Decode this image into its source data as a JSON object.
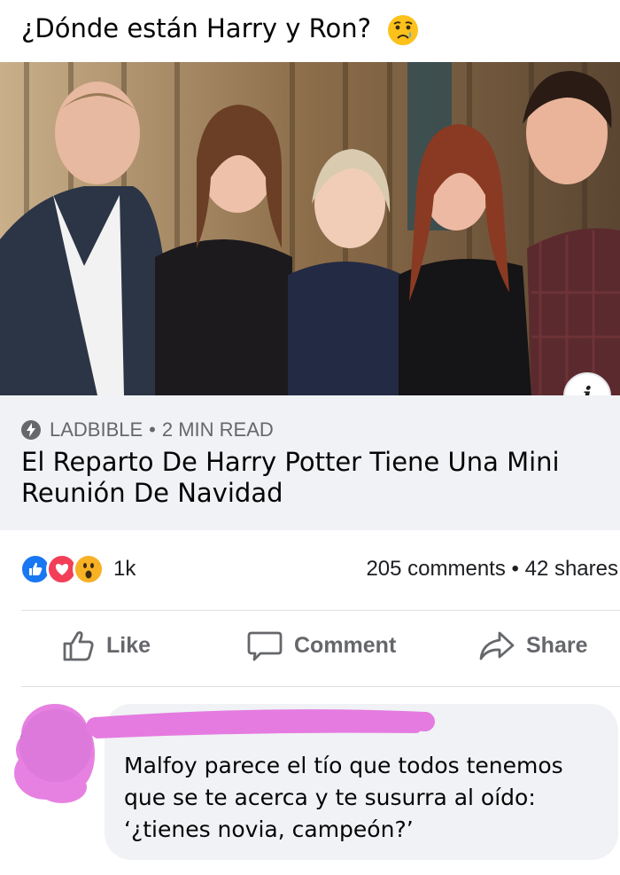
{
  "post": {
    "text": "¿Dónde están Harry y Ron?",
    "emoji_icon": "crying-face-emoji"
  },
  "link_card": {
    "source": "LADBIBLE",
    "separator": "•",
    "read_time": "2 MIN READ",
    "headline": "El Reparto De Harry Potter Tiene Una Mini Reunión De Navidad",
    "info_label": "i"
  },
  "reactions": {
    "icons": [
      "like-reaction-icon",
      "love-reaction-icon",
      "wow-reaction-icon"
    ],
    "count": "1k",
    "comments": "205 comments",
    "separator": "•",
    "shares": "42 shares"
  },
  "actions": {
    "like": "Like",
    "comment": "Comment",
    "share": "Share"
  },
  "comment": {
    "author": "",
    "text": "Malfoy parece el tío que todos tenemos que se te acerca y te susurra al oído: ‘¿tienes novia, campeón?’"
  },
  "colors": {
    "facebook_blue": "#1877f2",
    "love_red": "#f33e58",
    "wow_yellow": "#f7b125",
    "card_gray": "#f0f2f5",
    "muted_text": "#65676b",
    "scribble_pink": "#e57be0"
  }
}
